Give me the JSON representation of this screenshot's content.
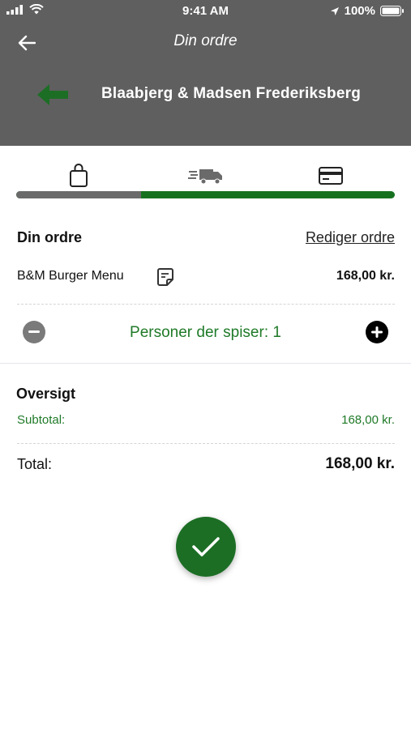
{
  "status_bar": {
    "time": "9:41 AM",
    "battery": "100%",
    "icons": [
      "signal-icon",
      "wifi-icon",
      "location-icon",
      "battery-icon"
    ]
  },
  "nav": {
    "title": "Din ordre",
    "back_icon": "arrow-left-icon"
  },
  "restaurant": {
    "name": "Blaabjerg & Madsen Frederiksberg",
    "icon": "green-arrow-left-icon"
  },
  "steps": {
    "icons": [
      "shopping-bag-icon",
      "delivery-truck-icon",
      "credit-card-icon"
    ],
    "progress_completed_fraction": 0.33
  },
  "order": {
    "title": "Din ordre",
    "edit_label": "Rediger ordre",
    "items": [
      {
        "name": "B&M Burger Menu",
        "price": "168,00 kr."
      }
    ]
  },
  "persons": {
    "label": "Personer der spiser: 1"
  },
  "overview": {
    "title": "Oversigt",
    "subtotal_label": "Subtotal:",
    "subtotal_value": "168,00 kr.",
    "total_label": "Total:",
    "total_value": "168,00 kr."
  },
  "colors": {
    "header_bg": "#5f5f5f",
    "brand_green": "#1c6e25",
    "text_green": "#1f7a28",
    "progress_gray": "#6a6a6a"
  }
}
